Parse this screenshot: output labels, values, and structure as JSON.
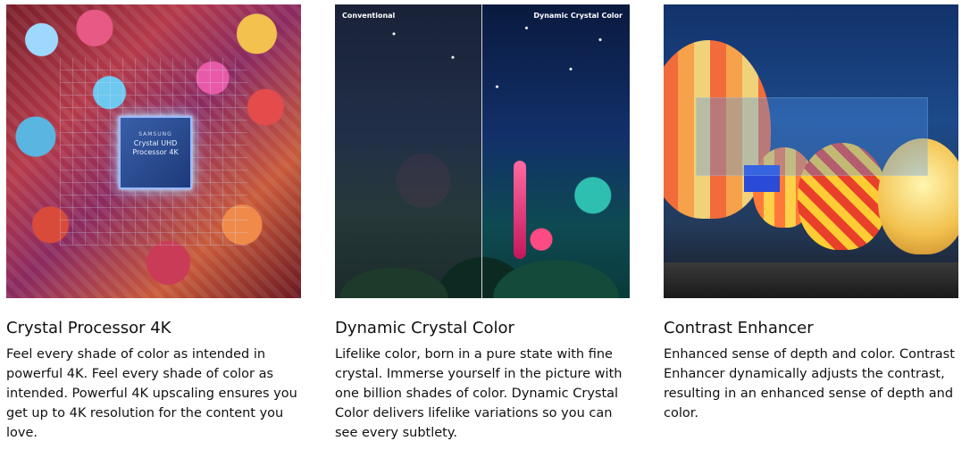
{
  "cards": [
    {
      "title": "Crystal Processor 4K",
      "description": "Feel every shade of color as intended in powerful 4K. Feel every shade of color as intended. Powerful 4K upscaling ensures you get up to 4K resolution for the content you love.",
      "image": {
        "chip_brand": "SAMSUNG",
        "chip_line1": "Crystal UHD",
        "chip_line2": "Processor 4K"
      }
    },
    {
      "title": "Dynamic Crystal Color",
      "description": "Lifelike color, born in a pure state with fine crystal. Immerse yourself in the picture with one billion shades of color. Dynamic Crystal Color delivers lifelike variations so you can see every subtlety.",
      "image": {
        "label_left": "Conventional",
        "label_right": "Dynamic Crystal Color"
      }
    },
    {
      "title": "Contrast Enhancer",
      "description": "Enhanced sense of depth and color. Contrast Enhancer dynamically adjusts the contrast, resulting in an enhanced sense of depth and color.",
      "image": {}
    }
  ]
}
